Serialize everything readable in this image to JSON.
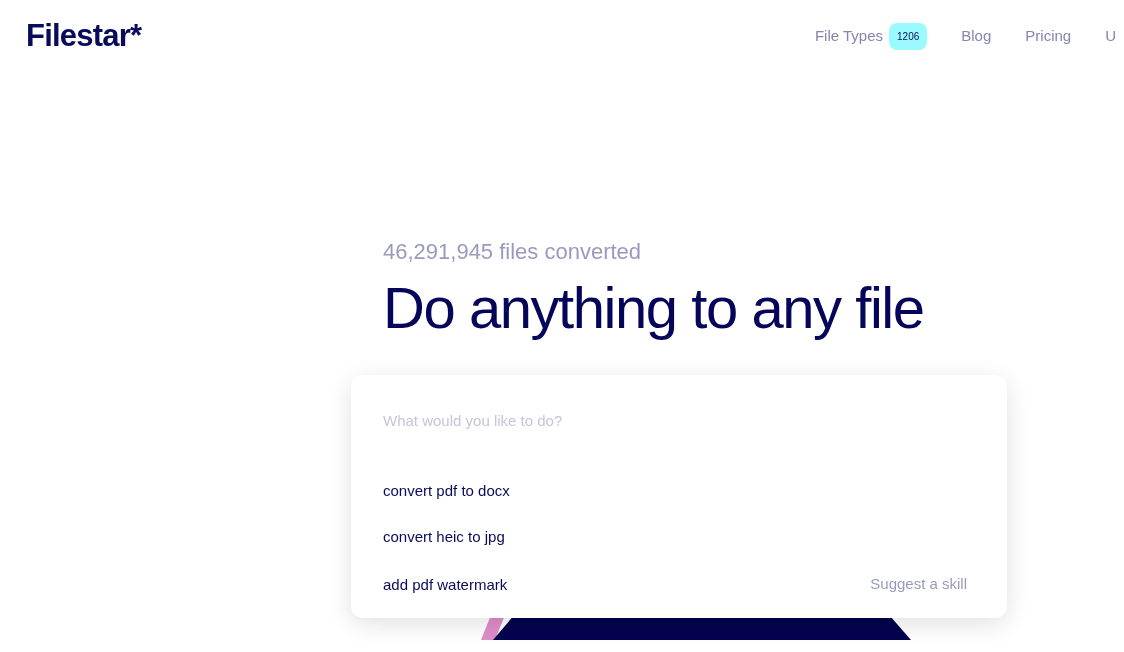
{
  "header": {
    "logo": "Filestar*",
    "nav": [
      {
        "label": "File Types",
        "badge": "1206"
      },
      {
        "label": "Blog"
      },
      {
        "label": "Pricing"
      },
      {
        "label": "U"
      }
    ]
  },
  "hero": {
    "counter": "46,291,945 files converted",
    "title": "Do anything to any file"
  },
  "search": {
    "placeholder": "What would you like to do?",
    "suggestions": [
      "convert pdf to docx",
      "convert heic to jpg",
      "add pdf watermark"
    ],
    "suggest_link": "Suggest a skill"
  }
}
